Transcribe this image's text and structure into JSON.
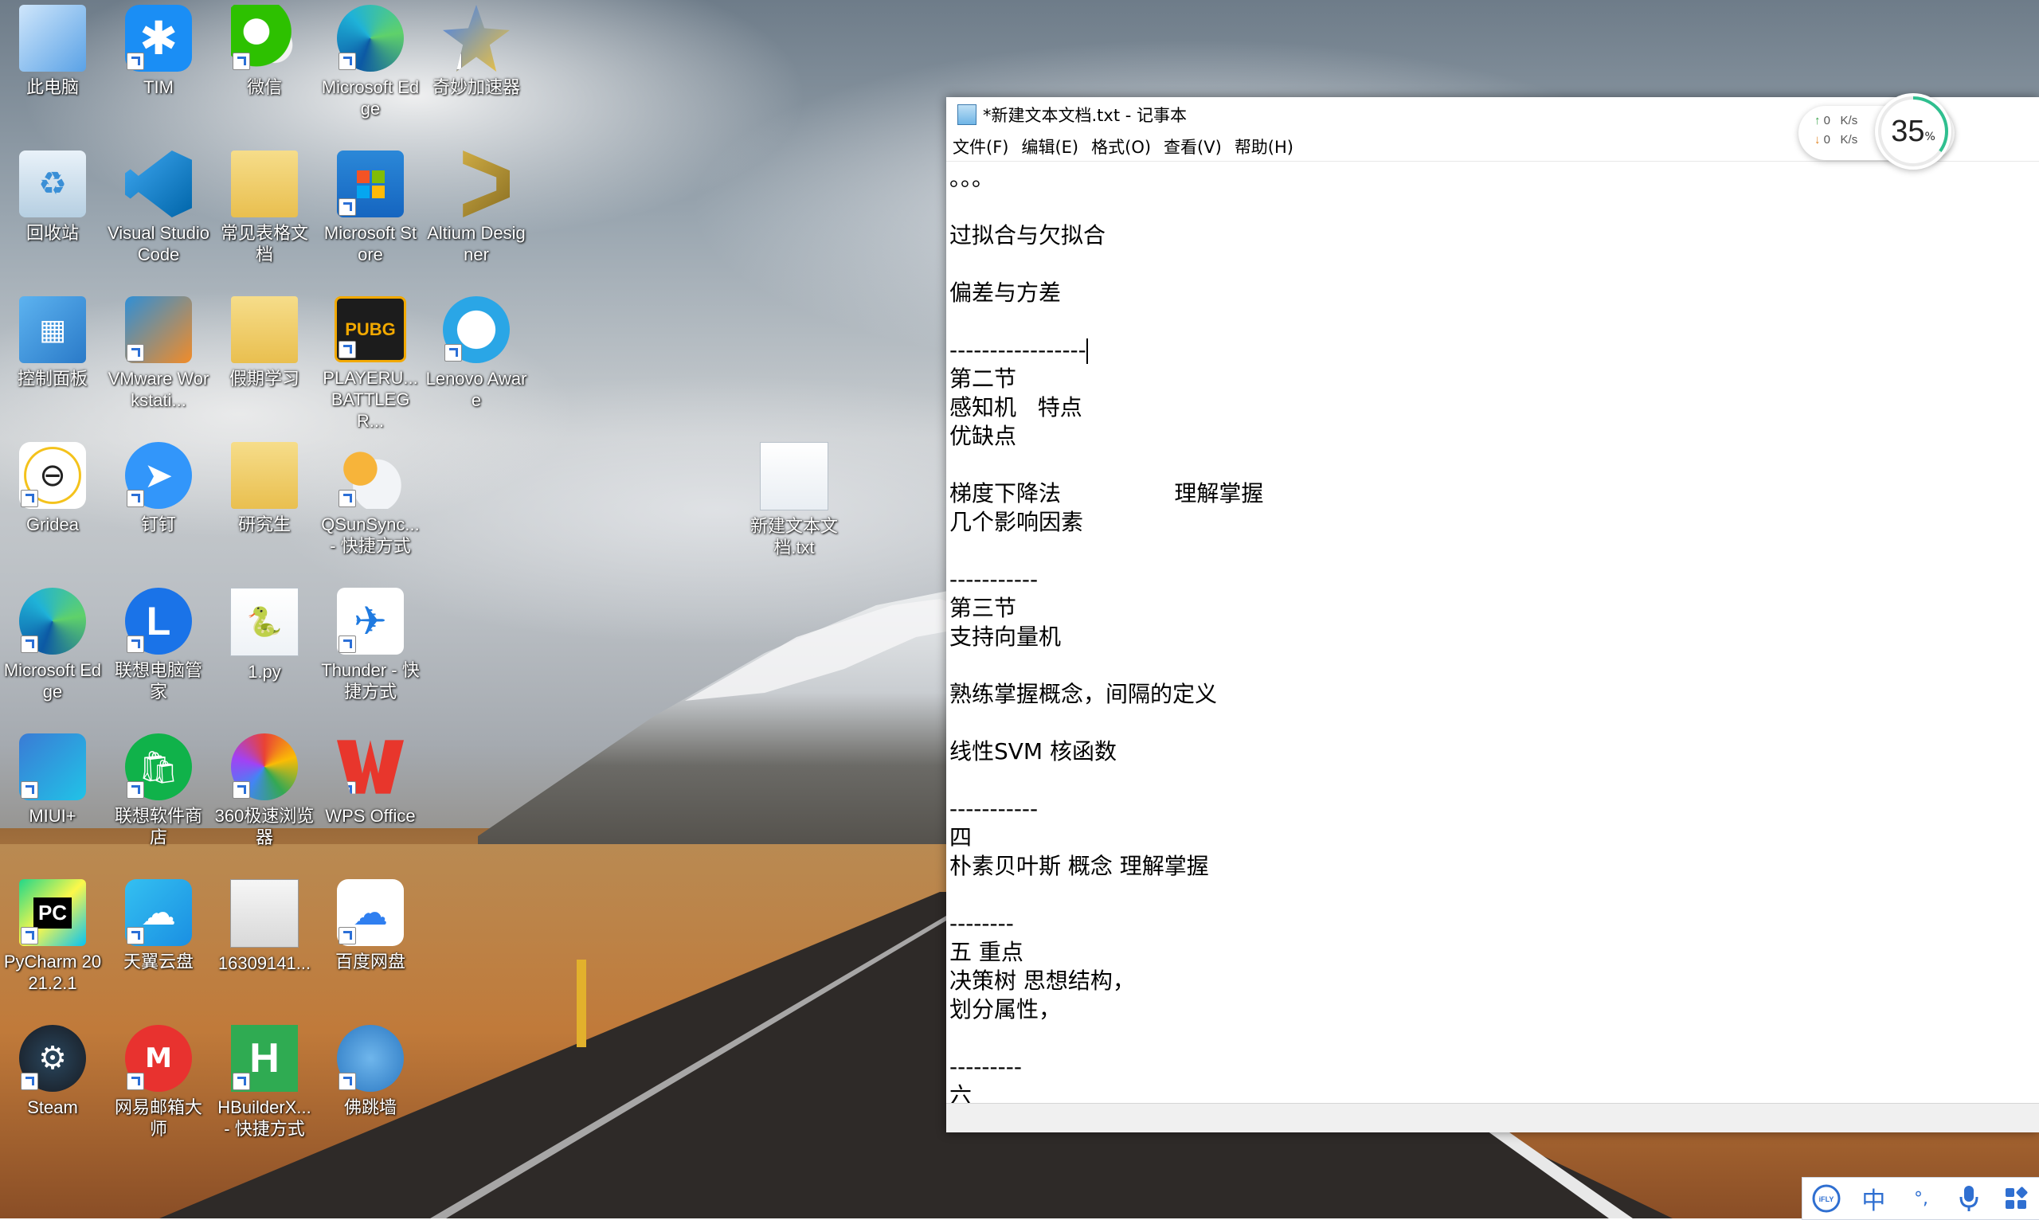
{
  "desktop": {
    "icons": [
      {
        "label": "此电脑",
        "icon": "this-pc-icon"
      },
      {
        "label": "TIM",
        "icon": "tim-icon"
      },
      {
        "label": "微信",
        "icon": "wechat-icon"
      },
      {
        "label": "Microsoft Edge",
        "icon": "edge-icon"
      },
      {
        "label": "奇妙加速器",
        "icon": "qimiao-accelerator-icon"
      },
      {
        "label": "回收站",
        "icon": "recycle-bin-icon"
      },
      {
        "label": "Visual Studio Code",
        "icon": "vscode-icon"
      },
      {
        "label": "常见表格文档",
        "icon": "folder-icon"
      },
      {
        "label": "Microsoft Store",
        "icon": "store-icon"
      },
      {
        "label": "Altium Designer",
        "icon": "altium-icon"
      },
      {
        "label": "控制面板",
        "icon": "control-panel-icon"
      },
      {
        "label": "VMware Workstati...",
        "icon": "vmware-icon"
      },
      {
        "label": "假期学习",
        "icon": "folder-icon"
      },
      {
        "label": "PLAYERU... BATTLEGR...",
        "icon": "pubg-icon"
      },
      {
        "label": "Lenovo Aware",
        "icon": "lenovo-aware-icon"
      },
      {
        "label": "Gridea",
        "icon": "gridea-icon"
      },
      {
        "label": "钉钉",
        "icon": "dingtalk-icon"
      },
      {
        "label": "研究生",
        "icon": "folder-icon"
      },
      {
        "label": "QSunSync... - 快捷方式",
        "icon": "qsunsync-icon"
      },
      {
        "label": "新建文本文档.txt",
        "icon": "text-file-icon"
      },
      {
        "label": "Microsoft Edge",
        "icon": "edge-icon"
      },
      {
        "label": "联想电脑管家",
        "icon": "lenovo-manager-icon"
      },
      {
        "label": "1.py",
        "icon": "python-file-icon"
      },
      {
        "label": "Thunder - 快捷方式",
        "icon": "thunder-icon"
      },
      {
        "label": "MIUI+",
        "icon": "miui-icon"
      },
      {
        "label": "联想软件商店",
        "icon": "lenovo-store-icon"
      },
      {
        "label": "360极速浏览器",
        "icon": "360-browser-icon"
      },
      {
        "label": "WPS Office",
        "icon": "wps-icon"
      },
      {
        "label": "PyCharm 2021.2.1",
        "icon": "pycharm-icon"
      },
      {
        "label": "天翼云盘",
        "icon": "tianyi-cloud-icon"
      },
      {
        "label": "16309141...",
        "icon": "photo-file-icon"
      },
      {
        "label": "百度网盘",
        "icon": "baidu-netdisk-icon"
      },
      {
        "label": "Steam",
        "icon": "steam-icon"
      },
      {
        "label": "网易邮箱大师",
        "icon": "netease-mail-icon"
      },
      {
        "label": "HBuilderX... - 快捷方式",
        "icon": "hbuilderx-icon"
      },
      {
        "label": "佛跳墙",
        "icon": "fotiaoqiang-icon"
      }
    ]
  },
  "notepad": {
    "title": "*新建文本文档.txt - 记事本",
    "menu": [
      "文件(F)",
      "编辑(E)",
      "格式(O)",
      "查看(V)",
      "帮助(H)"
    ],
    "lines": [
      "。。。",
      "",
      "过拟合与欠拟合",
      "",
      "偏差与方差",
      "",
      "-----------------",
      "第二节",
      "感知机   特点",
      "优缺点",
      "",
      "梯度下降法                理解掌握",
      "几个影响因素",
      "",
      "-----------",
      "第三节",
      "支持向量机",
      "",
      "熟练掌握概念，间隔的定义",
      "",
      "线性SVM 核函数",
      "",
      "-----------",
      "四",
      "朴素贝叶斯 概念 理解掌握",
      "",
      "--------",
      "五 重点",
      "决策树 思想结构，",
      "划分属性，",
      "",
      "---------",
      "六"
    ]
  },
  "network_monitor": {
    "upload": "0",
    "download": "0",
    "unit": "K/s",
    "percent": "35",
    "percent_sign": "%",
    "percent_value": 0.35
  },
  "ime": {
    "brand": "iFLY",
    "mode": "中",
    "punct": "°,",
    "tools": [
      "microphone-icon",
      "grid-apps-icon"
    ]
  }
}
